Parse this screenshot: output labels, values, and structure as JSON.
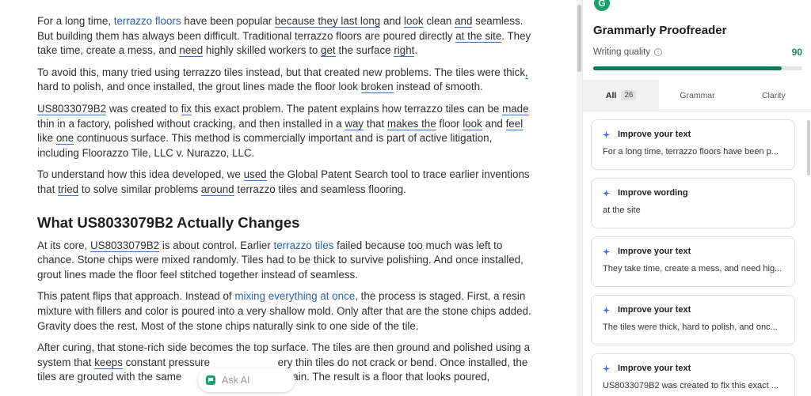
{
  "document": {
    "p1": {
      "t0": "For a long time, ",
      "l0": "terrazzo floors",
      "t1": " have been popular ",
      "u0": "because they last long",
      "t2": " and ",
      "u1": "look",
      "t3": " clean ",
      "u2": "and",
      "t4": " seamless. But building them has always been difficult. Traditional terrazzo floors are poured directly ",
      "u3": "at the site",
      "t5": ". They take time, create a mess, and ",
      "u4": "need",
      "t6": " highly skilled workers to ",
      "u5": "get",
      "t7": " the surface ",
      "u6": "right",
      "t8": "."
    },
    "p2": {
      "t0": "To avoid this, many tried using terrazzo tiles instead, but that created new problems. The tiles were thick",
      "u0": ",",
      "t1": " hard to polish, and once installed, the grout lines made the floor look ",
      "u1": "broken",
      "t2": " instead of smooth."
    },
    "p3": {
      "u0": "US8033079B2",
      "t0": " was created to ",
      "u1": "fix",
      "t1": " this exact problem. The patent explains how terrazzo tiles can be ",
      "u2": "made",
      "t2": " thin in a factory, polished without cracking, and then installed in a ",
      "u3": "way",
      "t3": " that ",
      "u4": "makes the",
      "t4": " floor ",
      "u5": "look",
      "t5": " and ",
      "u6": "feel",
      "t6": " like ",
      "u7": "one",
      "t7": " continuous surface. This method is commercially important and is part of active litigation, including Floorazzo Tile, LLC v. Nurazzo, LLC."
    },
    "p4": {
      "t0": "To understand how this idea developed, we ",
      "u0": "used",
      "t1": " the Global Patent Search tool to trace earlier inventions that ",
      "u1": "tried",
      "t2": " to solve similar problems ",
      "u2": "around",
      "t3": " terrazzo tiles and seamless flooring."
    },
    "heading": "What US8033079B2 Actually Changes",
    "p5": {
      "t0": "At its core, ",
      "u0": "US8033079B2",
      "t1": " is about control. Earlier ",
      "l0": "terrazzo tiles",
      "t2": " failed because too much was left to chance. Stone chips were mixed randomly. Tiles had to be thick to survive polishing. And once installed, grout lines made the floor feel stitched together instead of seamless."
    },
    "p6": {
      "t0": "This patent flips that approach. Instead of ",
      "l0": "mixing everything at once",
      "t1": ", the process is staged. First, a resin mixture with fillers and color is poured into a very shallow mold. Only after that are the stone chips added. Gravity does the rest. Most of the stone chips naturally sink to one side of the tile."
    },
    "p7": {
      "t0": "After curing, that stone-rich side becomes the top surface. The tiles are then ground and polished using a system that ",
      "u0": "keeps",
      "t1": " constant pressure",
      "t2": "ery thin tiles do not crack or bend. Once installed, the tiles are grouted with the same",
      "t3": "ished again. The result is a floor that looks poured,"
    }
  },
  "ask_ai": {
    "label": "Ask AI",
    "icon": "chat-bubble-icon"
  },
  "panel": {
    "logo_letter": "G",
    "title": "Grammarly Proofreader",
    "writing_quality_label": "Writing quality",
    "score": "90",
    "score_fraction": 0.9,
    "accent_color": "#117a50",
    "tabs": [
      {
        "label": "All",
        "count": "26"
      },
      {
        "label": "Grammar"
      },
      {
        "label": "Clarity"
      }
    ],
    "cards": [
      {
        "type": "Improve your text",
        "text": "For a long time, terrazzo floors have been p..."
      },
      {
        "type": "Improve wording",
        "text": "at the site"
      },
      {
        "type": "Improve your text",
        "text": "They take time, create a mess, and need hig..."
      },
      {
        "type": "Improve your text",
        "text": "The tiles were thick, hard to polish, and onc..."
      },
      {
        "type": "Improve your text",
        "text": "US8033079B2 was created to fix this exact ..."
      }
    ]
  }
}
